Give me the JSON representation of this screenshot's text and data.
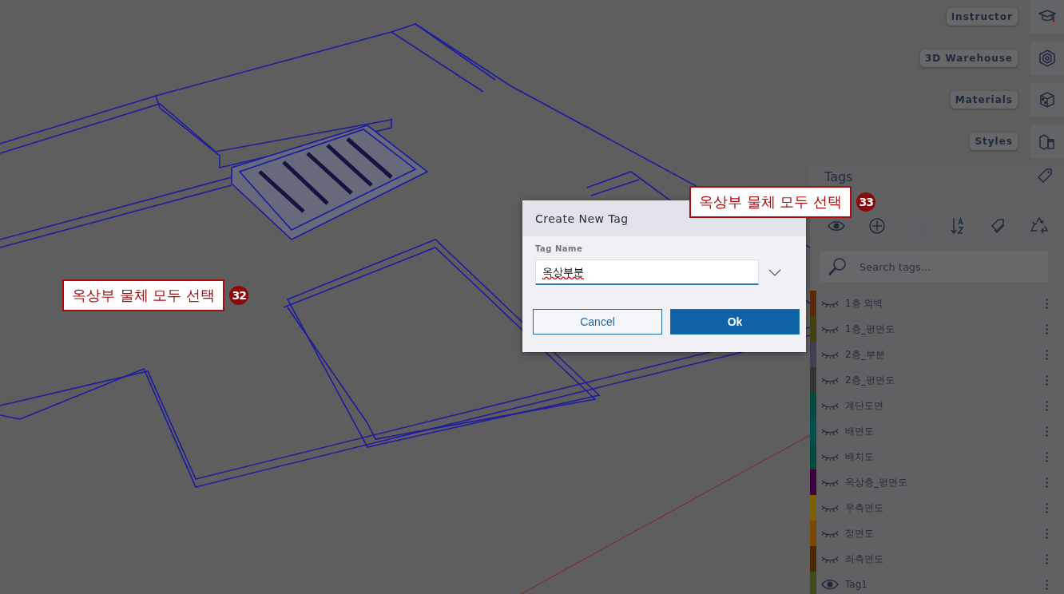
{
  "tool_buttons": [
    {
      "label": "Instructor",
      "kind": "instructor"
    },
    {
      "label": "3D Warehouse",
      "kind": "warehouse"
    },
    {
      "label": "Materials",
      "kind": "materials"
    },
    {
      "label": "Styles",
      "kind": "styles"
    }
  ],
  "tags_panel": {
    "title": "Tags",
    "search": {
      "placeholder": "Search tags..."
    },
    "tags": [
      {
        "name": "1층 외벽",
        "color": "#5c2a08",
        "visible": false
      },
      {
        "name": "1층_평면도",
        "color": "#44420f",
        "visible": false
      },
      {
        "name": "2층_부분",
        "color": "#3f3f52",
        "visible": false
      },
      {
        "name": "2층_평면도",
        "color": "#343434",
        "visible": false
      },
      {
        "name": "계단도면",
        "color": "#004a40",
        "visible": false
      },
      {
        "name": "배면도",
        "color": "#004e52",
        "visible": false
      },
      {
        "name": "배치도",
        "color": "#00483c",
        "visible": false
      },
      {
        "name": "옥상층_평면도",
        "color": "#3a0040",
        "visible": false
      },
      {
        "name": "우측면도",
        "color": "#7a6000",
        "visible": false
      },
      {
        "name": "정면도",
        "color": "#784800",
        "visible": false
      },
      {
        "name": "좌측면도",
        "color": "#4a2800",
        "visible": false
      },
      {
        "name": "Tag1",
        "color": "#3c4a22",
        "visible": true
      }
    ]
  },
  "dialog": {
    "title": "Create New Tag",
    "field_label": "Tag Name",
    "value": "옥상부분",
    "buttons": [
      {
        "label": "Cancel",
        "kind": "secondary"
      },
      {
        "label": "Ok",
        "kind": "primary"
      }
    ]
  },
  "annotations": [
    {
      "text": "옥상부 물체 모두 선택",
      "number": "32"
    },
    {
      "text": "옥상부 물체 모두 선택",
      "number": "33"
    }
  ]
}
